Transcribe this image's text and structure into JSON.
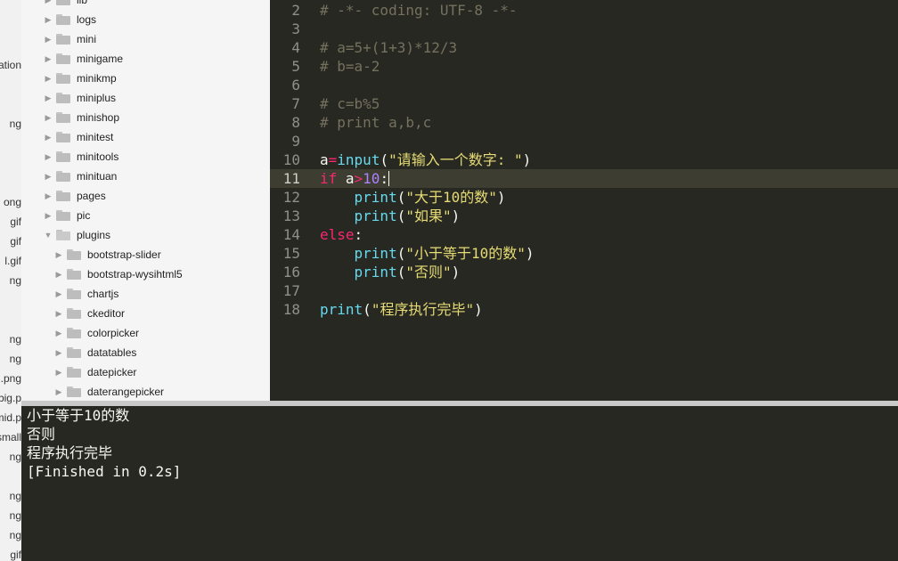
{
  "left_strip": {
    "fragments": [
      "ation",
      "ng",
      "ong",
      "gif",
      "gif",
      "l.gif",
      "ng",
      "ng",
      "ng",
      ".png",
      "big.p",
      "mid.p",
      "small",
      "ng",
      "ng",
      "ng",
      "ng",
      "gif"
    ]
  },
  "sidebar": {
    "items": [
      {
        "label": "lib",
        "expanded": false
      },
      {
        "label": "logs",
        "expanded": false
      },
      {
        "label": "mini",
        "expanded": false
      },
      {
        "label": "minigame",
        "expanded": false
      },
      {
        "label": "minikmp",
        "expanded": false
      },
      {
        "label": "miniplus",
        "expanded": false
      },
      {
        "label": "minishop",
        "expanded": false
      },
      {
        "label": "minitest",
        "expanded": false
      },
      {
        "label": "minitools",
        "expanded": false
      },
      {
        "label": "minituan",
        "expanded": false
      },
      {
        "label": "pages",
        "expanded": false
      },
      {
        "label": "pic",
        "expanded": false
      },
      {
        "label": "plugins",
        "expanded": true
      },
      {
        "label": "bootstrap-slider",
        "expanded": false
      },
      {
        "label": "bootstrap-wysihtml5",
        "expanded": false
      },
      {
        "label": "chartjs",
        "expanded": false
      },
      {
        "label": "ckeditor",
        "expanded": false
      },
      {
        "label": "colorpicker",
        "expanded": false
      },
      {
        "label": "datatables",
        "expanded": false
      },
      {
        "label": "datepicker",
        "expanded": false
      },
      {
        "label": "daterangepicker",
        "expanded": false
      }
    ]
  },
  "editor": {
    "lines": [
      {
        "n": "2",
        "parts": [
          {
            "t": "# -*- coding: UTF-8 -*-",
            "c": "comment"
          }
        ]
      },
      {
        "n": "3",
        "parts": []
      },
      {
        "n": "4",
        "parts": [
          {
            "t": "# a=5+(1+3)*12/3",
            "c": "comment"
          }
        ]
      },
      {
        "n": "5",
        "parts": [
          {
            "t": "# b=a-2",
            "c": "comment"
          }
        ]
      },
      {
        "n": "6",
        "parts": []
      },
      {
        "n": "7",
        "parts": [
          {
            "t": "# c=b%5",
            "c": "comment"
          }
        ]
      },
      {
        "n": "8",
        "parts": [
          {
            "t": "# print a,b,c",
            "c": "comment"
          }
        ]
      },
      {
        "n": "9",
        "parts": []
      },
      {
        "n": "10",
        "parts": [
          {
            "t": "a",
            "c": "plain"
          },
          {
            "t": "=",
            "c": "op"
          },
          {
            "t": "input",
            "c": "fn"
          },
          {
            "t": "(",
            "c": "plain"
          },
          {
            "t": "\"请输入一个数字: \"",
            "c": "str"
          },
          {
            "t": ")",
            "c": "plain"
          }
        ]
      },
      {
        "n": "11",
        "current": true,
        "parts": [
          {
            "t": "if",
            "c": "kw"
          },
          {
            "t": " a",
            "c": "plain"
          },
          {
            "t": ">",
            "c": "op"
          },
          {
            "t": "10",
            "c": "num"
          },
          {
            "t": ":",
            "c": "plain"
          }
        ]
      },
      {
        "n": "12",
        "parts": [
          {
            "t": "    ",
            "c": "plain"
          },
          {
            "t": "print",
            "c": "fn"
          },
          {
            "t": "(",
            "c": "plain"
          },
          {
            "t": "\"大于10的数\"",
            "c": "str"
          },
          {
            "t": ")",
            "c": "plain"
          }
        ]
      },
      {
        "n": "13",
        "parts": [
          {
            "t": "    ",
            "c": "plain"
          },
          {
            "t": "print",
            "c": "fn"
          },
          {
            "t": "(",
            "c": "plain"
          },
          {
            "t": "\"如果\"",
            "c": "str"
          },
          {
            "t": ")",
            "c": "plain"
          }
        ]
      },
      {
        "n": "14",
        "parts": [
          {
            "t": "else",
            "c": "kw"
          },
          {
            "t": ":",
            "c": "plain"
          }
        ]
      },
      {
        "n": "15",
        "parts": [
          {
            "t": "    ",
            "c": "plain"
          },
          {
            "t": "print",
            "c": "fn"
          },
          {
            "t": "(",
            "c": "plain"
          },
          {
            "t": "\"小于等于10的数\"",
            "c": "str"
          },
          {
            "t": ")",
            "c": "plain"
          }
        ]
      },
      {
        "n": "16",
        "parts": [
          {
            "t": "    ",
            "c": "plain"
          },
          {
            "t": "print",
            "c": "fn"
          },
          {
            "t": "(",
            "c": "plain"
          },
          {
            "t": "\"否则\"",
            "c": "str"
          },
          {
            "t": ")",
            "c": "plain"
          }
        ]
      },
      {
        "n": "17",
        "parts": []
      },
      {
        "n": "18",
        "parts": [
          {
            "t": "print",
            "c": "fn"
          },
          {
            "t": "(",
            "c": "plain"
          },
          {
            "t": "\"程序执行完毕\"",
            "c": "str"
          },
          {
            "t": ")",
            "c": "plain"
          }
        ]
      }
    ]
  },
  "output": {
    "lines": [
      "小于等于10的数",
      "否则",
      "程序执行完毕",
      "[Finished in 0.2s]"
    ]
  }
}
